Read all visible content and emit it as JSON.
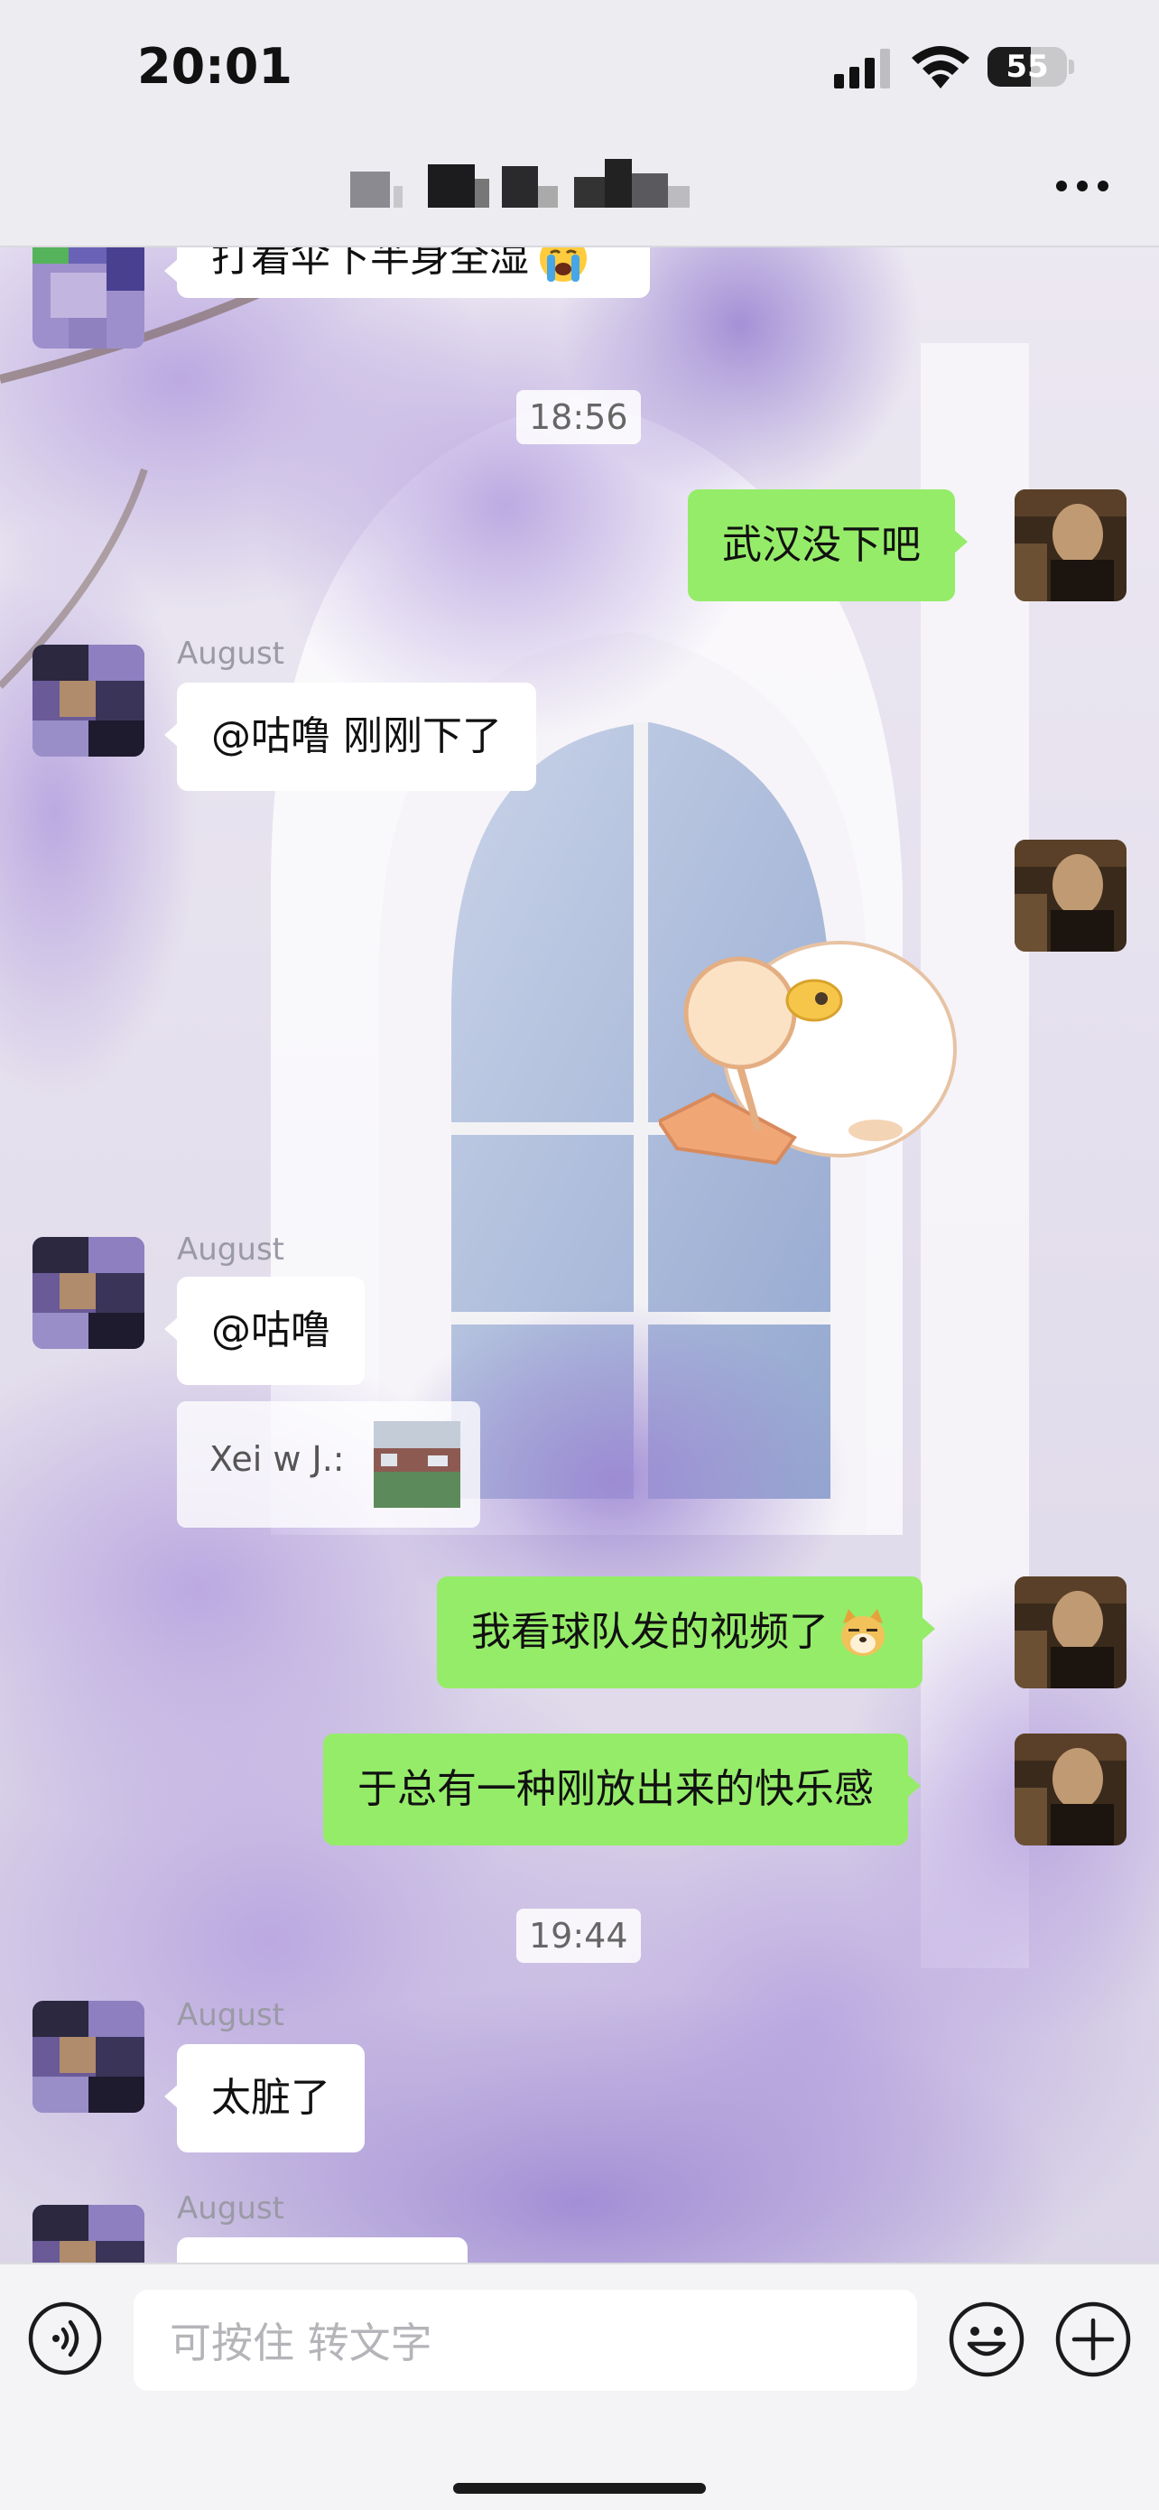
{
  "status_bar": {
    "time": "20:01",
    "battery": "55",
    "battery_level": 0.55,
    "icons": [
      "cellular-signal-icon",
      "wifi-icon",
      "battery-icon"
    ]
  },
  "header": {
    "title_blurred": true,
    "more_icon": "more-dots-icon"
  },
  "messages": [
    {
      "side": "left",
      "text": "打着伞下半身全湿",
      "emoji": "crying-face-emoji"
    },
    {
      "type": "timestamp",
      "text": "18:56"
    },
    {
      "side": "right",
      "text": "武汉没下吧"
    },
    {
      "side": "left",
      "sender": "August",
      "text": "@咕噜 刚刚下了"
    },
    {
      "side": "right",
      "type": "sticker",
      "sticker": "duck-with-fan-sticker"
    },
    {
      "side": "left",
      "sender": "August",
      "text": "@咕噜"
    },
    {
      "side": "left",
      "type": "quote",
      "text": "Xei w J.:",
      "thumb": "stadium-photo-thumbnail"
    },
    {
      "side": "right",
      "text": "我看球队发的视频了",
      "emoji": "doge-emoji"
    },
    {
      "side": "right",
      "text": "于总有一种刚放出来的快乐感"
    },
    {
      "type": "timestamp",
      "text": "19:44"
    },
    {
      "side": "left",
      "sender": "August",
      "text": "太脏了"
    },
    {
      "side": "left",
      "sender": "August",
      "text": ""
    }
  ],
  "input_bar": {
    "placeholder": "可按住 转文字",
    "icons": [
      "voice-input-icon",
      "emoji-icon",
      "plus-icon"
    ]
  },
  "colors": {
    "bubble_self": "#95ec69",
    "bubble_other": "#ffffff",
    "bar_background": "#ececf1"
  }
}
